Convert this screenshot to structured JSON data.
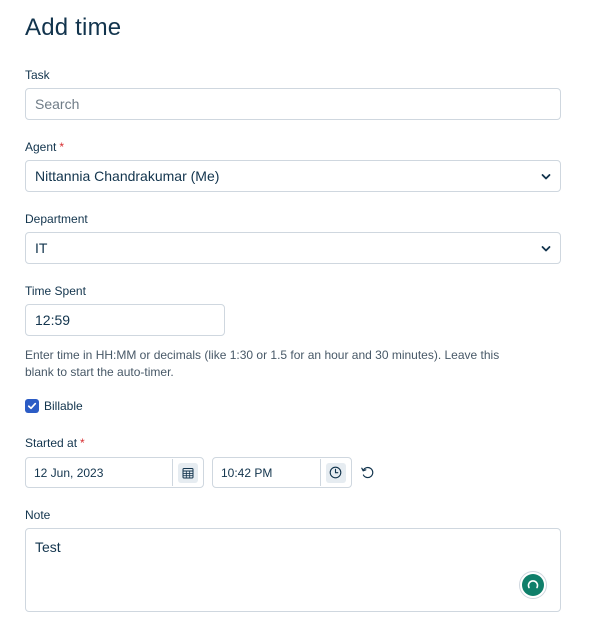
{
  "page": {
    "title": "Add time"
  },
  "task": {
    "label": "Task",
    "placeholder": "Search"
  },
  "agent": {
    "label": "Agent",
    "required_mark": "*",
    "value": "Nittannia Chandrakumar (Me)"
  },
  "department": {
    "label": "Department",
    "value": "IT"
  },
  "time_spent": {
    "label": "Time Spent",
    "value": "12:59",
    "help": "Enter time in HH:MM or decimals (like 1:30 or 1.5 for an hour and 30 minutes). Leave this blank to start the auto-timer."
  },
  "billable": {
    "label": "Billable",
    "checked": true
  },
  "started_at": {
    "label": "Started at",
    "required_mark": "*",
    "date": "12 Jun, 2023",
    "time": "10:42 PM"
  },
  "note": {
    "label": "Note",
    "value": "Test"
  },
  "colors": {
    "accent": "#2c5cc5",
    "required": "#d72d30",
    "fab": "#0f7f6a",
    "border": "#cfd7df",
    "text": "#12344d"
  },
  "icons": {
    "date_picker": "calendar-icon",
    "time_picker": "clock-icon",
    "reset": "reset-icon",
    "select": "chevron-down-icon",
    "checkbox": "check-icon",
    "assistant": "assistant-fab-icon"
  }
}
